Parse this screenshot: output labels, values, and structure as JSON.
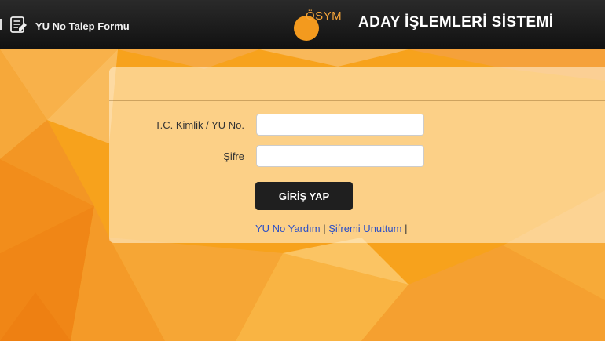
{
  "header": {
    "form_link_label": "YU No Talep Formu",
    "brand_text": "ÖSYM",
    "system_title": "ADAY İŞLEMLERİ SİSTEMİ"
  },
  "login": {
    "id_label": "T.C. Kimlik / YU No.",
    "id_value": "",
    "password_label": "Şifre",
    "password_value": "",
    "submit_label": "GİRİŞ YAP",
    "help_link": "YU No Yardım",
    "forgot_link": "Şifremi Unuttum",
    "separator": "|"
  },
  "colors": {
    "background": "#f7a21c",
    "header": "#1a1a1a",
    "accent": "#f39a1e",
    "link": "#2b4fc7"
  }
}
